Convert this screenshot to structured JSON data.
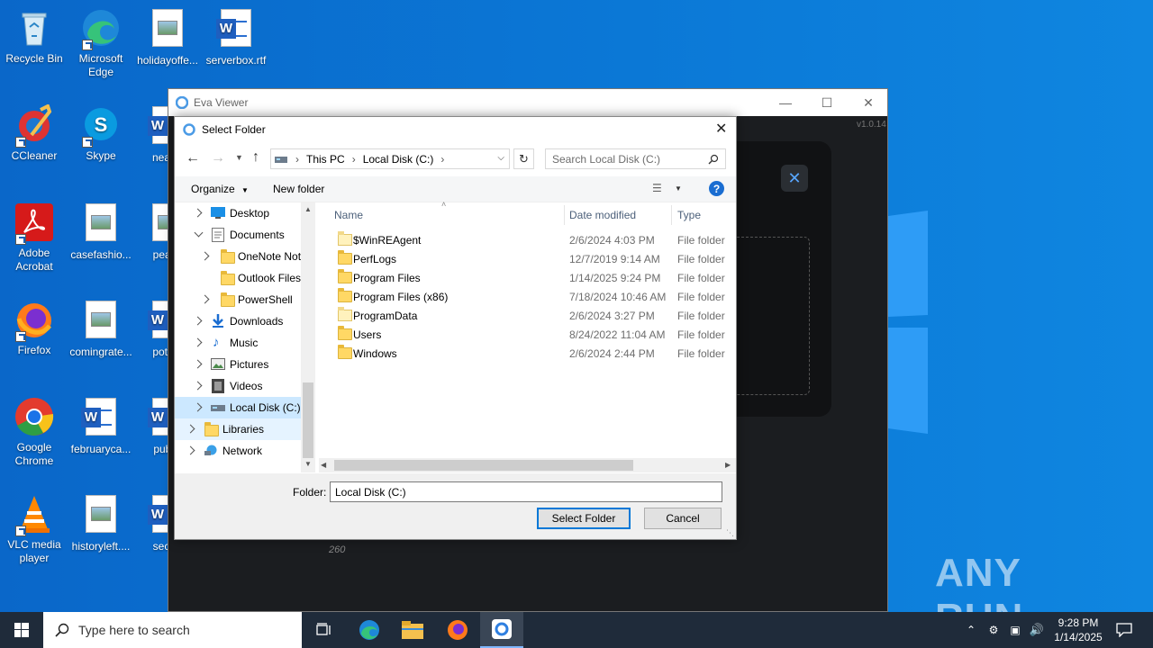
{
  "desktop": {
    "icons": [
      {
        "label": "Recycle Bin"
      },
      {
        "label": "Microsoft Edge"
      },
      {
        "label": "holidayoffe..."
      },
      {
        "label": "serverbox.rtf"
      },
      {
        "label": "CCleaner"
      },
      {
        "label": "Skype"
      },
      {
        "label": "nearm"
      },
      {
        "label": "Adobe Acrobat"
      },
      {
        "label": "casefashio..."
      },
      {
        "label": "peace"
      },
      {
        "label": "Firefox"
      },
      {
        "label": "comingrate..."
      },
      {
        "label": "potent"
      },
      {
        "label": "Google Chrome"
      },
      {
        "label": "februaryca..."
      },
      {
        "label": "publis"
      },
      {
        "label": "VLC media player"
      },
      {
        "label": "historyleft...."
      },
      {
        "label": "sector"
      }
    ],
    "watermark": "ANY RUN"
  },
  "eva_window": {
    "title": "Eva Viewer",
    "version": "v1.0.14",
    "bg_number": "260"
  },
  "dialog": {
    "title": "Select Folder",
    "breadcrumb": [
      "This PC",
      "Local Disk (C:)"
    ],
    "search_placeholder": "Search Local Disk (C:)",
    "organize_label": "Organize",
    "new_folder_label": "New folder",
    "nav_items": [
      {
        "label": "Desktop"
      },
      {
        "label": "Documents"
      },
      {
        "label": "OneNote Not"
      },
      {
        "label": "Outlook Files"
      },
      {
        "label": "PowerShell"
      },
      {
        "label": "Downloads"
      },
      {
        "label": "Music"
      },
      {
        "label": "Pictures"
      },
      {
        "label": "Videos"
      },
      {
        "label": "Local Disk (C:)"
      },
      {
        "label": "Libraries"
      },
      {
        "label": "Network"
      }
    ],
    "columns": {
      "name": "Name",
      "date": "Date modified",
      "type": "Type"
    },
    "files": [
      {
        "name": "$WinREAgent",
        "date": "2/6/2024 4:03 PM",
        "type": "File folder"
      },
      {
        "name": "PerfLogs",
        "date": "12/7/2019 9:14 AM",
        "type": "File folder"
      },
      {
        "name": "Program Files",
        "date": "1/14/2025 9:24 PM",
        "type": "File folder"
      },
      {
        "name": "Program Files (x86)",
        "date": "7/18/2024 10:46 AM",
        "type": "File folder"
      },
      {
        "name": "ProgramData",
        "date": "2/6/2024 3:27 PM",
        "type": "File folder"
      },
      {
        "name": "Users",
        "date": "8/24/2022 11:04 AM",
        "type": "File folder"
      },
      {
        "name": "Windows",
        "date": "2/6/2024 2:44 PM",
        "type": "File folder"
      }
    ],
    "folder_label": "Folder:",
    "folder_value": "Local Disk (C:)",
    "select_button": "Select Folder",
    "cancel_button": "Cancel"
  },
  "taskbar": {
    "search_placeholder": "Type here to search",
    "time": "9:28 PM",
    "date": "1/14/2025"
  }
}
